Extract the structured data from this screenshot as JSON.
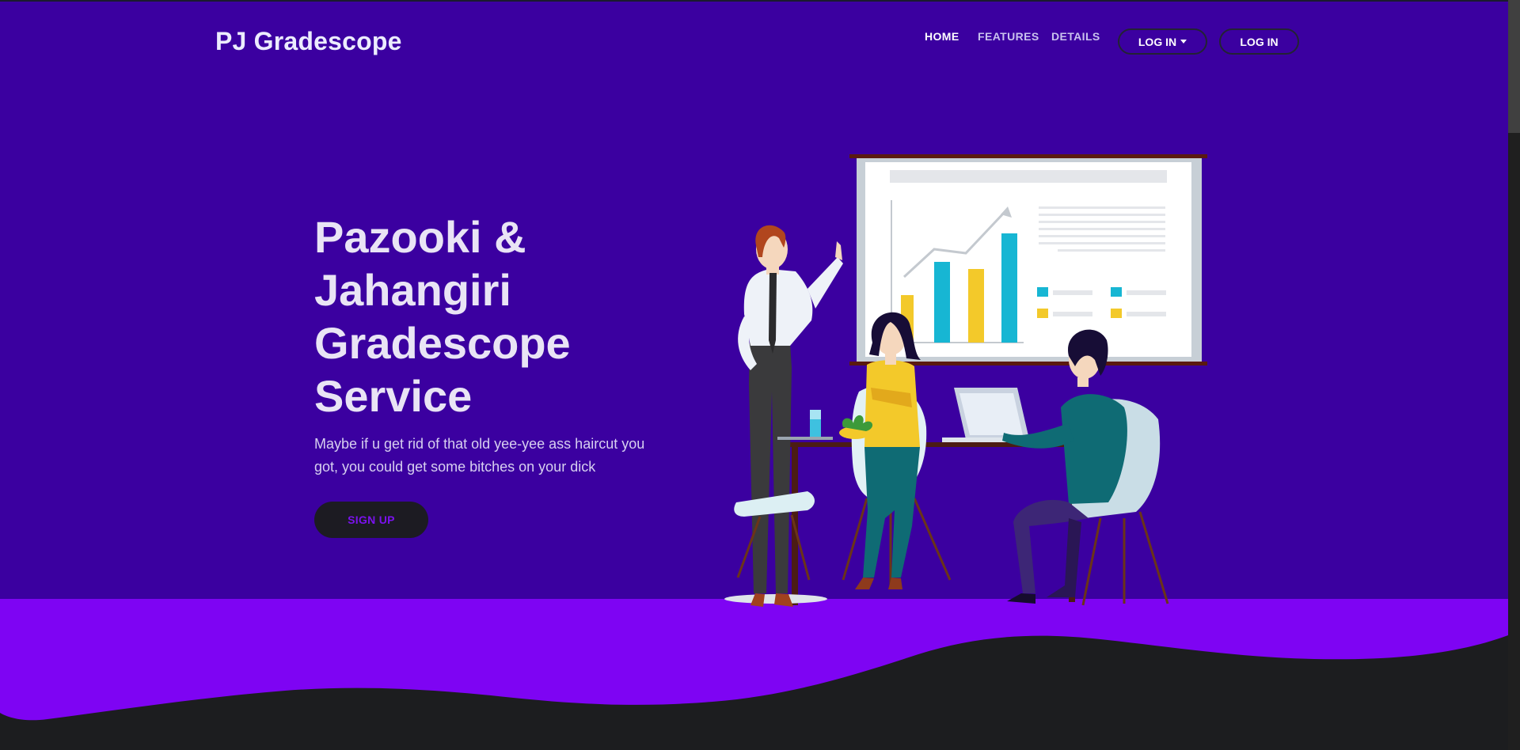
{
  "nav": {
    "brand": "PJ Gradescope",
    "links": [
      "HOME",
      "FEATURES",
      "DETAILS"
    ],
    "login_dropdown_label": "LOG IN",
    "login_label": "LOG IN"
  },
  "hero": {
    "title": "Pazooki & Jahangiri Gradescope Service",
    "subtitle": "Maybe if u get rid of that old yee-yee ass haircut you got, you could get some bitches on your dick",
    "cta_label": "SIGN UP"
  },
  "colors": {
    "hero_bg": "#3b00a0",
    "wave_purple": "#7e04f3",
    "dark": "#1c1d1f",
    "cta_text": "#7a12ee"
  },
  "illustration": {
    "icon": "office-meeting-illustration"
  }
}
